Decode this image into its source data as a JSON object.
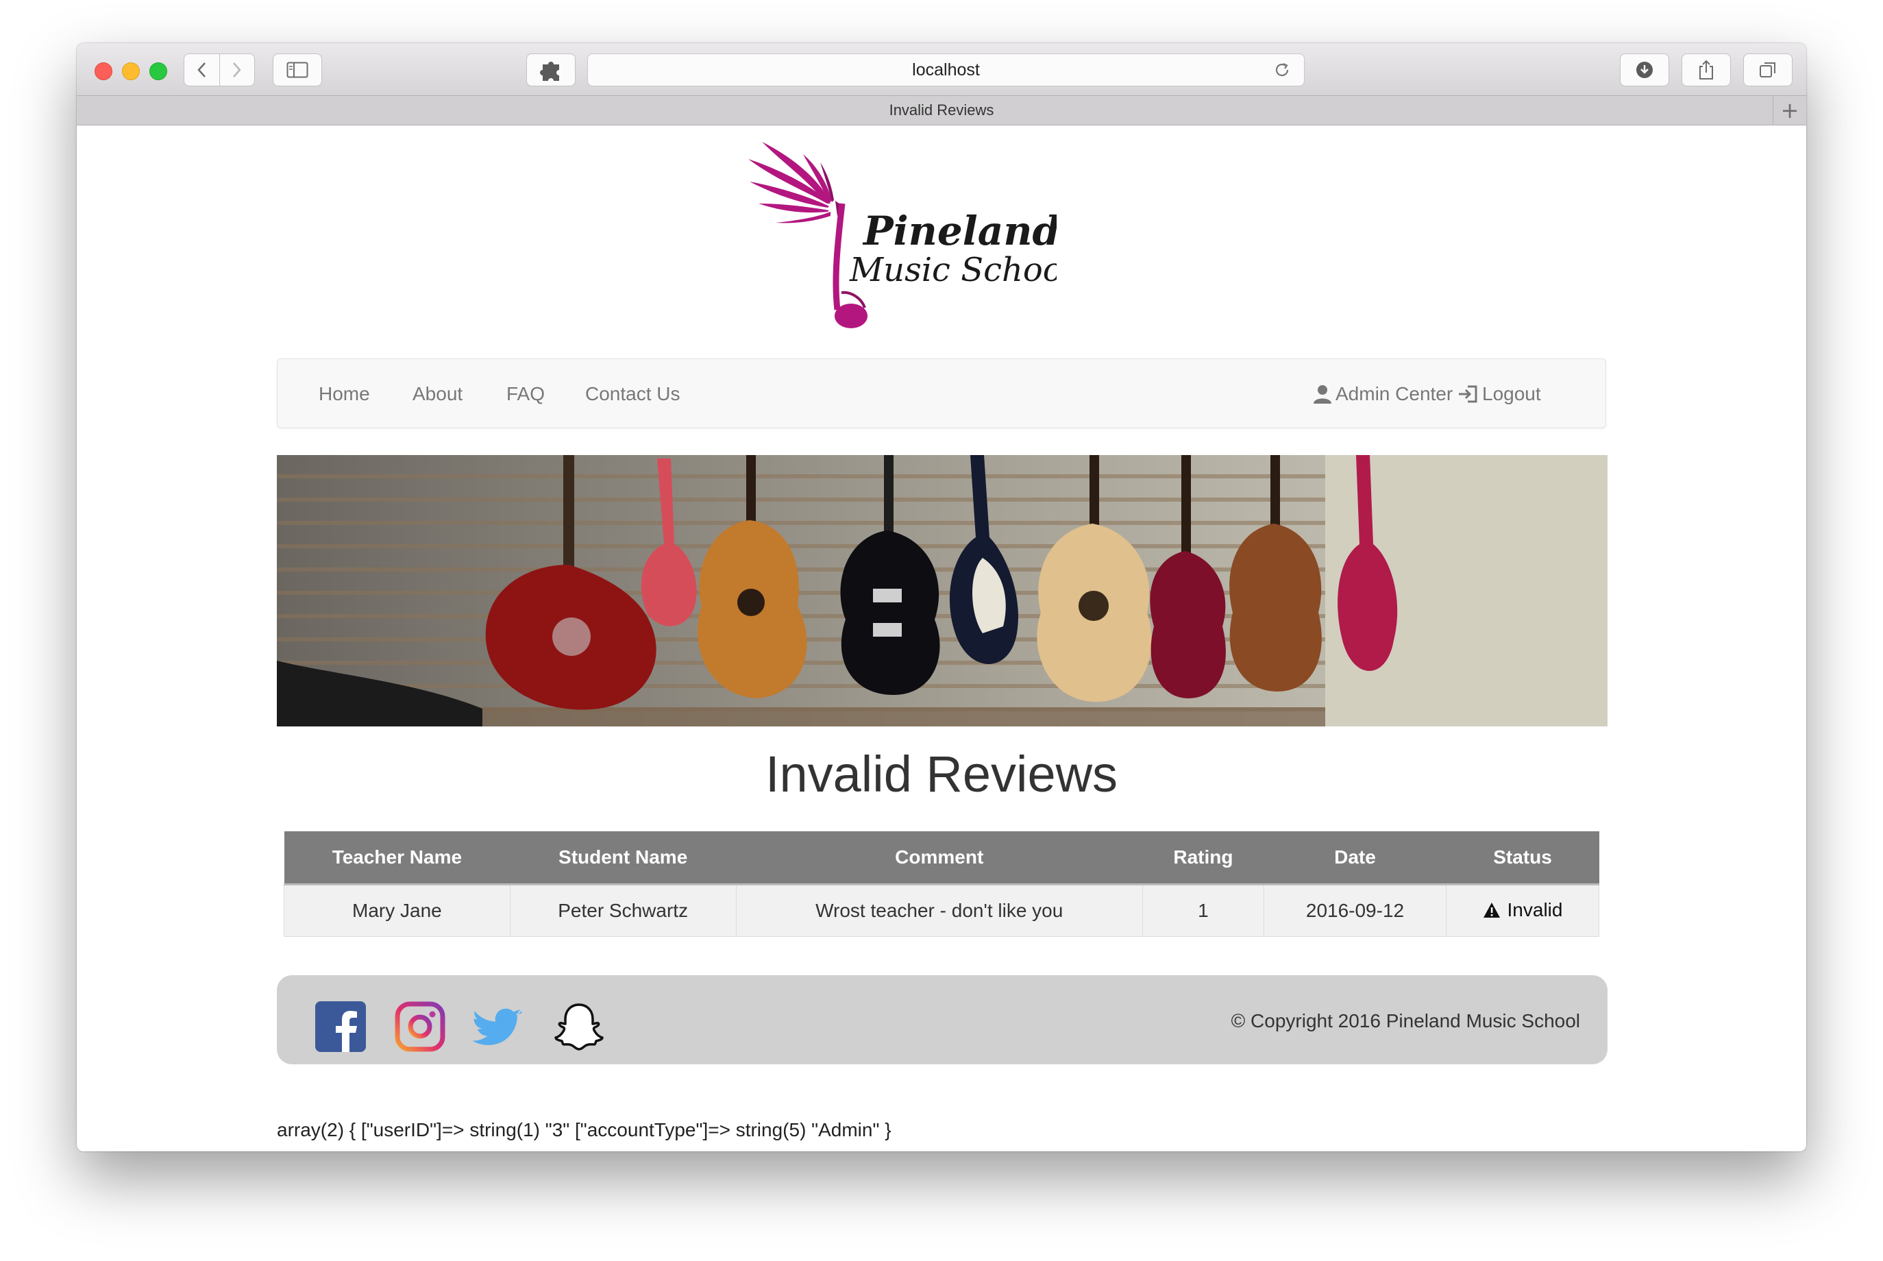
{
  "browser": {
    "address": "localhost",
    "tab_title": "Invalid Reviews"
  },
  "logo": {
    "line1": "Pinelands",
    "line2": "Music School",
    "accent_color": "#b3177f"
  },
  "nav": {
    "left": [
      "Home",
      "About",
      "FAQ",
      "Contact Us"
    ],
    "admin": "Admin Center",
    "logout": "Logout"
  },
  "page": {
    "title": "Invalid Reviews"
  },
  "table": {
    "headers": [
      "Teacher Name",
      "Student Name",
      "Comment",
      "Rating",
      "Date",
      "Status"
    ],
    "rows": [
      {
        "teacher": "Mary Jane",
        "student": "Peter Schwartz",
        "comment": "Wrost teacher - don't like you",
        "rating": "1",
        "date": "2016-09-12",
        "status": "Invalid"
      }
    ]
  },
  "footer": {
    "social": [
      "facebook-icon",
      "instagram-icon",
      "twitter-icon",
      "snapchat-icon"
    ],
    "copyright": "© Copyright 2016 Pineland Music School"
  },
  "debug_output": "array(2) { [\"userID\"]=> string(1) \"3\" [\"accountType\"]=> string(5) \"Admin\" }",
  "colors": {
    "table_header": "#7d7d7d",
    "footer_bg": "#d0d0d0",
    "facebook": "#3b5998",
    "twitter": "#55acee"
  }
}
